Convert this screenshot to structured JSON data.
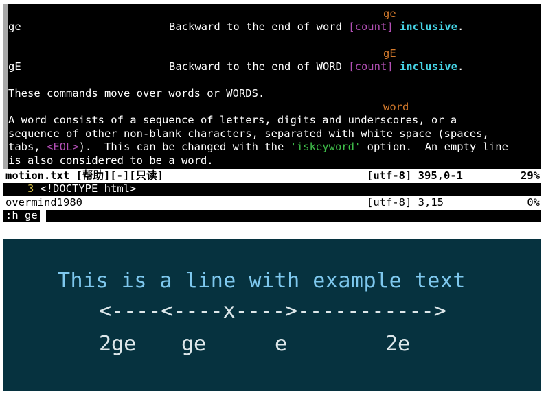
{
  "help": {
    "tag_ge": "ge",
    "cmd_ge": "ge",
    "desc_ge": "Backward to the end of word ",
    "tag_gE": "gE",
    "cmd_gE": "gE",
    "desc_gE": "Backward to the end of WORD ",
    "count": "[count]",
    "inclusive": "inclusive",
    "period": ".",
    "line_moves": "These commands move over words or WORDS.",
    "tag_word": "word",
    "para1": "A word consists of a sequence of letters, digits and underscores, or a",
    "para2": "sequence of other non-blank characters, separated with white space (spaces,",
    "para3_a": "tabs, ",
    "eol": "<EOL>",
    "para3_b": ").  This can be changed with the ",
    "iskeyword": "'iskeyword'",
    "para3_c": " option.  An empty line",
    "para4": "is also considered to be a word."
  },
  "status_help": {
    "file": "motion.txt [帮助][-][只读]",
    "encoding_pos": "[utf-8] 395,0-1",
    "percent": "29%"
  },
  "buffer": {
    "line_number": "3",
    "line_text": " <!DOCTYPE html>"
  },
  "status_buffer": {
    "file": "overmind1980",
    "encoding_pos": "[utf-8] 3,15",
    "percent": "0%"
  },
  "command_line": ":h ge",
  "illustration": {
    "text_line": "This is a line with example text",
    "arrow_line": "<----<----x---->-----------",
    "arrow_head": ">",
    "labels": [
      "2ge",
      "ge",
      "e",
      "2e"
    ]
  },
  "colors": {
    "terminal_bg": "#000000",
    "help_tag": "#d47a2c",
    "count": "#b24fb4",
    "inclusive": "#46d4e6",
    "option": "#3fbf4a",
    "illustration_bg": "#06323f",
    "illustration_text": "#7ec8ee"
  }
}
